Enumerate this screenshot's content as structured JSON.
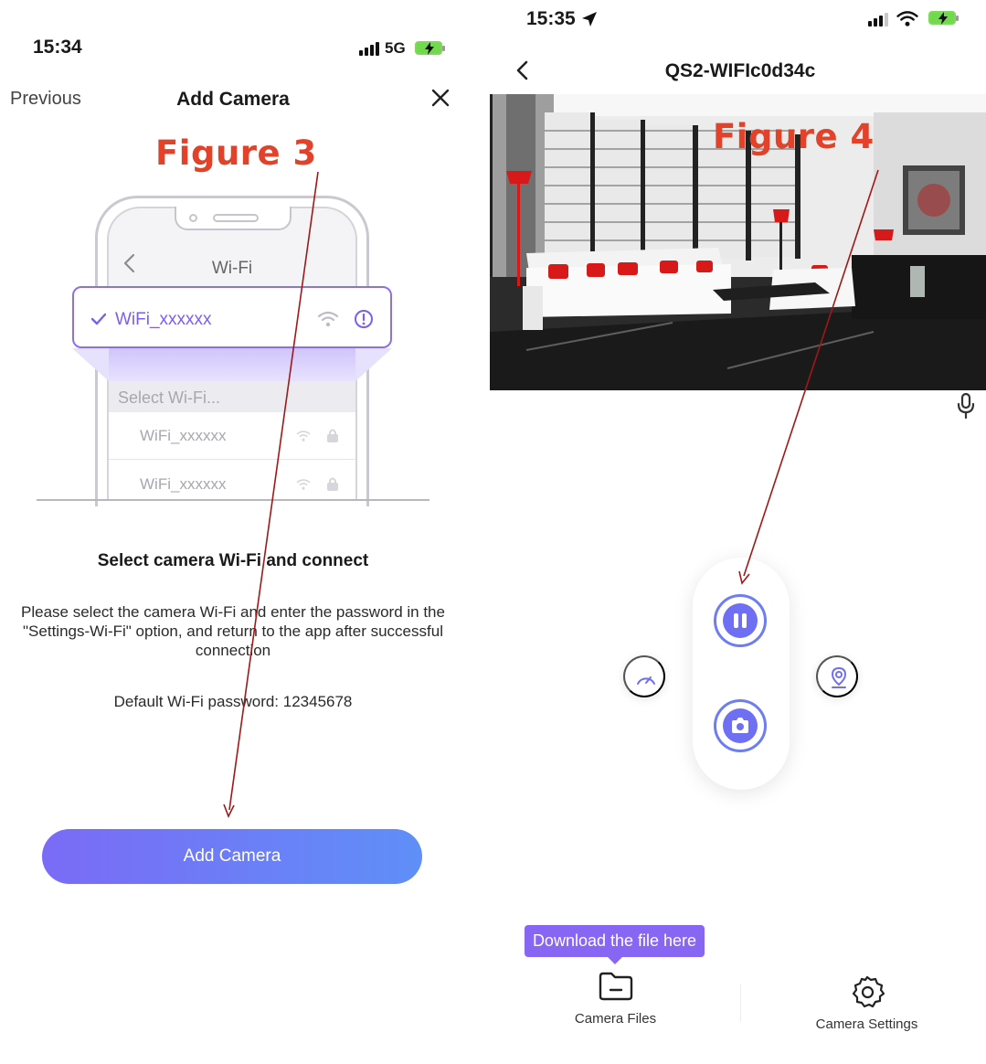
{
  "left": {
    "status_time": "15:34",
    "network": "5G",
    "nav": {
      "previous": "Previous",
      "title": "Add Camera"
    },
    "figure_label": "Figure 3",
    "illustration": {
      "screen_title": "Wi-Fi",
      "selected_network": "WiFi_xxxxxx",
      "list_header": "Select Wi-Fi...",
      "list": [
        "WiFi_xxxxxx",
        "WiFi_xxxxxx"
      ]
    },
    "heading": "Select camera Wi-Fi and connect",
    "instructions": "Please select the camera Wi-Fi and enter the password in the \"Settings-Wi-Fi\" option, and return to the app after successful connection",
    "default_password": "Default Wi-Fi password: 12345678",
    "add_button": "Add Camera"
  },
  "right": {
    "status_time": "15:35",
    "nav": {
      "title": "QS2-WIFIc0d34c"
    },
    "figure_label": "Figure 4",
    "tooltip": "Download the file here",
    "tabs": {
      "files": "Camera Files",
      "settings": "Camera Settings"
    }
  },
  "colors": {
    "accent": "#6e6ff3",
    "figure_label": "#e2412a",
    "arrow": "#a01818",
    "tooltip_bg": "#8866f4",
    "button_gradient_start": "#7a6bf6",
    "button_gradient_end": "#5f8ff7"
  },
  "icons": {
    "left_close": "close-icon",
    "right_back": "chevron-left-icon",
    "mic": "microphone-icon",
    "pause": "pause-icon",
    "snapshot": "camera-icon",
    "speed": "speedometer-icon",
    "location": "location-pin-icon",
    "files": "folder-icon",
    "settings": "gear-icon"
  }
}
